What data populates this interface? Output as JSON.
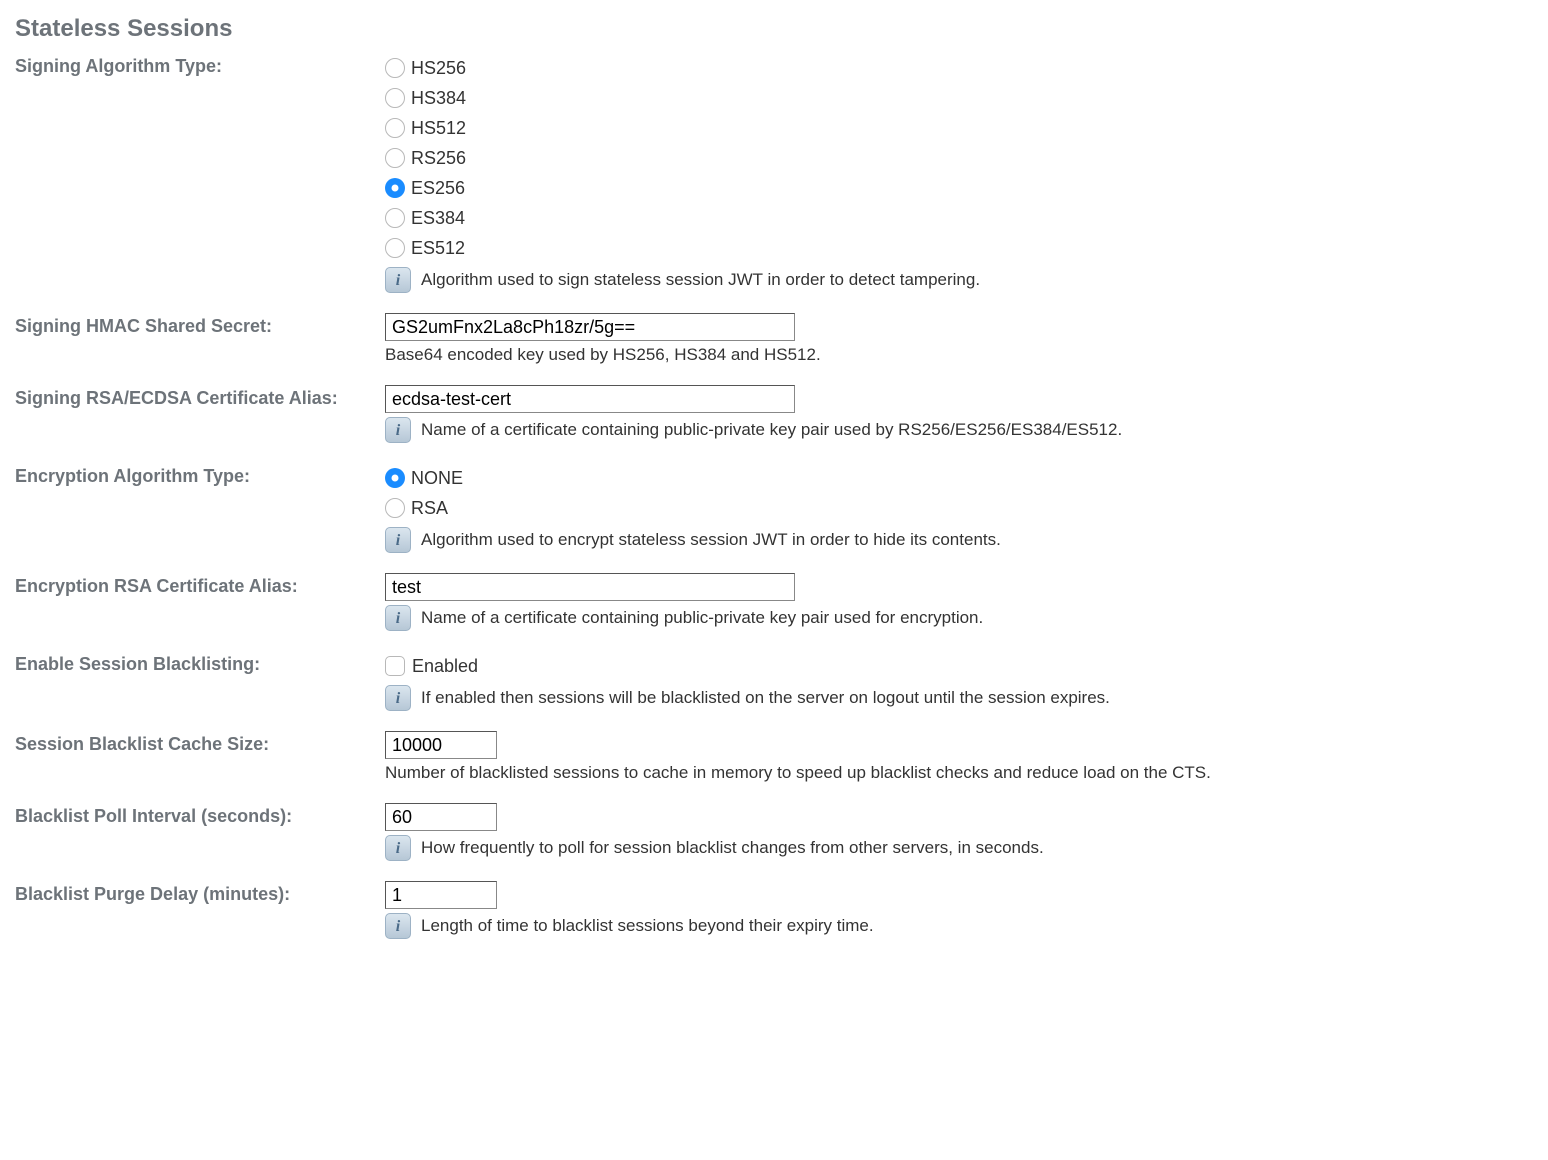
{
  "section_title": "Stateless Sessions",
  "signing_algo": {
    "label": "Signing Algorithm Type:",
    "options": [
      "HS256",
      "HS384",
      "HS512",
      "RS256",
      "ES256",
      "ES384",
      "ES512"
    ],
    "selected": "ES256",
    "info": "Algorithm used to sign stateless session JWT in order to detect tampering."
  },
  "hmac_secret": {
    "label": "Signing HMAC Shared Secret:",
    "value": "GS2umFnx2La8cPh18zr/5g==",
    "help": "Base64 encoded key used by HS256, HS384 and HS512."
  },
  "rsa_alias": {
    "label": "Signing RSA/ECDSA Certificate Alias:",
    "value": "ecdsa-test-cert",
    "info": "Name of a certificate containing public-private key pair used by RS256/ES256/ES384/ES512."
  },
  "enc_algo": {
    "label": "Encryption Algorithm Type:",
    "options": [
      "NONE",
      "RSA"
    ],
    "selected": "NONE",
    "info": "Algorithm used to encrypt stateless session JWT in order to hide its contents."
  },
  "enc_rsa_alias": {
    "label": "Encryption RSA Certificate Alias:",
    "value": "test",
    "info": "Name of a certificate containing public-private key pair used for encryption."
  },
  "blacklist_enable": {
    "label": "Enable Session Blacklisting:",
    "checkbox_label": "Enabled",
    "checked": false,
    "info": "If enabled then sessions will be blacklisted on the server on logout until the session expires."
  },
  "blacklist_cache": {
    "label": "Session Blacklist Cache Size:",
    "value": "10000",
    "help": "Number of blacklisted sessions to cache in memory to speed up blacklist checks and reduce load on the CTS."
  },
  "poll_interval": {
    "label": "Blacklist Poll Interval (seconds):",
    "value": "60",
    "info": "How frequently to poll for session blacklist changes from other servers, in seconds."
  },
  "purge_delay": {
    "label": "Blacklist Purge Delay (minutes):",
    "value": "1",
    "info": "Length of time to blacklist sessions beyond their expiry time."
  }
}
